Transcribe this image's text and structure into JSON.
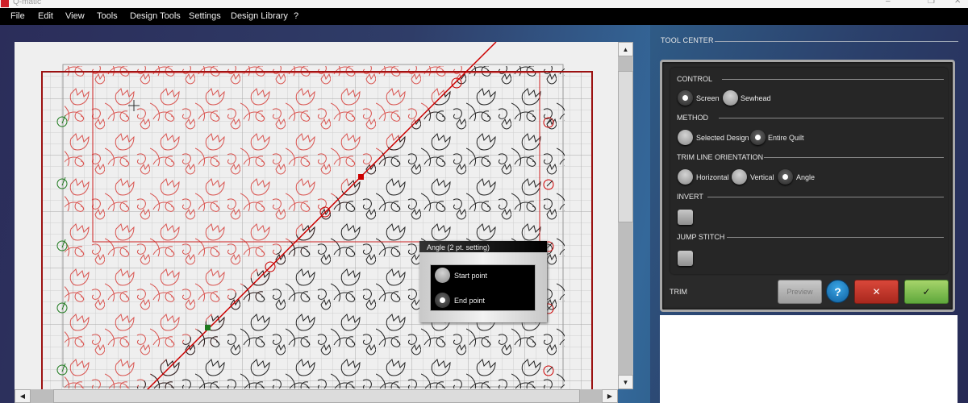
{
  "window": {
    "title": "Q-matic",
    "controls": [
      "minimize",
      "restore",
      "close"
    ]
  },
  "menu": {
    "items": [
      "File",
      "Edit",
      "View",
      "Tools",
      "Design Tools",
      "Settings",
      "Design Library",
      "?"
    ]
  },
  "canvas": {
    "pattern_colors": {
      "excluded": "#d9534f",
      "included": "#222222",
      "trim_line": "#cc0000",
      "border": "#9b1111",
      "start_marker": "#1e7a1e",
      "end_marker": "#cc0000"
    },
    "jump_markers_left_count": 5,
    "jump_markers_right_count": 5
  },
  "angle_popup": {
    "title": "Angle (2 pt. setting)",
    "options": [
      {
        "label": "Start point",
        "selected": false
      },
      {
        "label": "End point",
        "selected": true
      }
    ]
  },
  "tool_center": {
    "header": "TOOL CENTER",
    "sections": {
      "control": {
        "label": "CONTROL",
        "options": [
          {
            "label": "Screen",
            "selected": true
          },
          {
            "label": "Sewhead",
            "selected": false
          }
        ]
      },
      "method": {
        "label": "METHOD",
        "options": [
          {
            "label": "Selected Design",
            "selected": false
          },
          {
            "label": "Entire Quilt",
            "selected": true
          }
        ]
      },
      "orientation": {
        "label": "TRIM LINE ORIENTATION",
        "options": [
          {
            "label": "Horizontal",
            "selected": false
          },
          {
            "label": "Vertical",
            "selected": false
          },
          {
            "label": "Angle",
            "selected": true
          }
        ]
      },
      "invert": {
        "label": "INVERT",
        "checked": false
      },
      "jump_stitch": {
        "label": "JUMP STITCH",
        "checked": false
      }
    },
    "footer": {
      "label": "TRIM",
      "preview_label": "Preview",
      "help_label": "?",
      "cancel_label": "✕",
      "ok_label": "✓"
    }
  },
  "icons": {
    "scroll_up": "▲",
    "scroll_down": "▼",
    "scroll_left": "◀",
    "scroll_right": "▶",
    "minimize": "–",
    "restore": "❐",
    "close": "✕"
  }
}
